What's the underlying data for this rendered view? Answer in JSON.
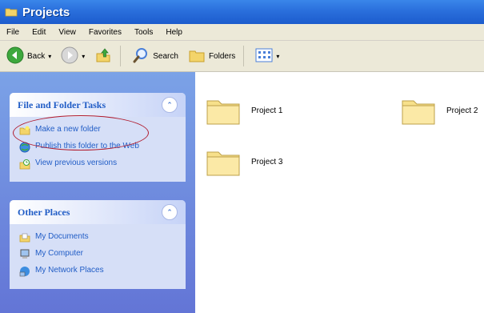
{
  "window": {
    "title": "Projects"
  },
  "menu": [
    "File",
    "Edit",
    "View",
    "Favorites",
    "Tools",
    "Help"
  ],
  "toolbar": {
    "back_label": "Back",
    "search_label": "Search",
    "folders_label": "Folders"
  },
  "tasks_panel": {
    "title": "File and Folder Tasks",
    "items": [
      {
        "label": "Make a new folder",
        "icon": "new-folder-icon"
      },
      {
        "label": "Publish this folder to the Web",
        "icon": "publish-web-icon"
      },
      {
        "label": "View previous versions",
        "icon": "previous-versions-icon"
      }
    ]
  },
  "places_panel": {
    "title": "Other Places",
    "items": [
      {
        "label": "My Documents",
        "icon": "my-documents-icon"
      },
      {
        "label": "My Computer",
        "icon": "my-computer-icon"
      },
      {
        "label": "My Network Places",
        "icon": "network-places-icon"
      }
    ]
  },
  "folders": [
    "Project 1",
    "Project 2",
    "Project 3"
  ],
  "colors": {
    "title_bar": "#2a6fdc",
    "task_link": "#215dc6",
    "annotation": "#b01a2c"
  }
}
